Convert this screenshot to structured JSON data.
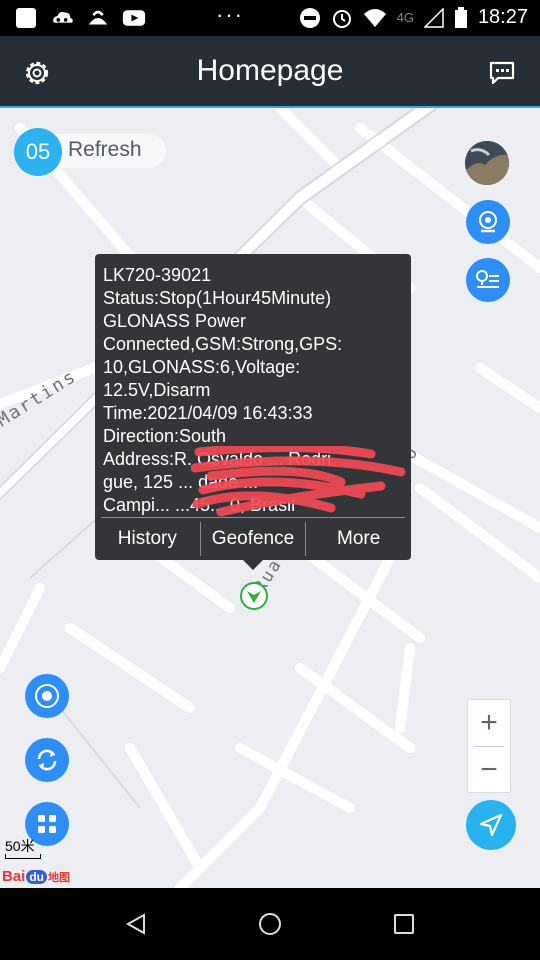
{
  "status_bar": {
    "time": "18:27",
    "network": "4G",
    "overflow": "···",
    "icons": [
      "square-icon",
      "cloud-icon",
      "coin-icon",
      "youtube-icon",
      "do-not-disturb-icon",
      "alarm-icon",
      "wifi-icon",
      "signal-icon",
      "battery-icon"
    ]
  },
  "header": {
    "title": "Homepage",
    "left_icon": "gear-icon",
    "right_icon": "message-icon",
    "accent": "#33a9e8"
  },
  "refresh": {
    "count": "05",
    "label": "Refresh"
  },
  "map": {
    "streets": [
      "Martins",
      "Rua Jos Sa",
      "ho"
    ],
    "scale_label": "50米",
    "logo": "Baidu地图"
  },
  "popup": {
    "lines": [
      "LK720-39021",
      "Status:Stop(1Hour45Minute)",
      "GLONASS Power",
      "Connected,GSM:Strong,GPS:",
      "10,GLONASS:6,Voltage:",
      "12.5V,Disarm",
      "Time:2021/04/09 16:43:33",
      "Direction:South",
      "Address:R. Osvaldo ...  Rodri",
      "gue, 125 ... dade ...",
      "Campi... ...45... 0, Brasil"
    ],
    "actions": [
      "History",
      "Geofence",
      "More"
    ]
  },
  "right_controls": [
    "satellite-thumbnail",
    "camera-icon",
    "location-list-icon"
  ],
  "left_controls": [
    "target-icon",
    "sync-icon",
    "grid-icon"
  ],
  "zoom": {
    "in": "+",
    "out": "−"
  },
  "colors": {
    "blue_button": "#2f8ef3",
    "cyan_button": "#29b3ee",
    "popup_bg": "#333538",
    "topbar": "#262e36"
  }
}
